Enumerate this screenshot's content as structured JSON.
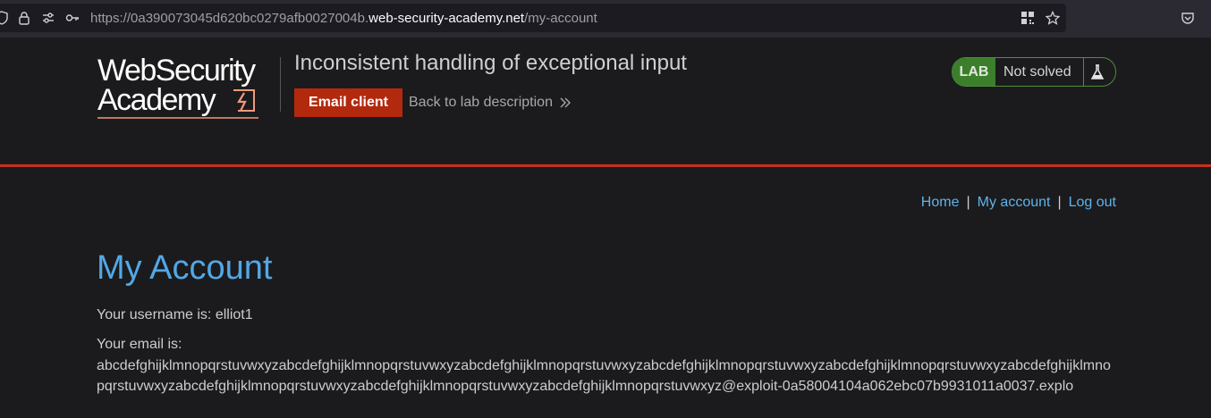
{
  "browser": {
    "url_prefix": "https://0a390073045d620bc0279afb0027004b.",
    "url_domain": "web-security-academy.net",
    "url_path": "/my-account"
  },
  "header": {
    "logo_line1": "WebSecurity",
    "logo_line2": "Academy",
    "lab_title": "Inconsistent handling of exceptional input",
    "email_client_label": "Email client",
    "back_link_label": "Back to lab description",
    "lab_badge": "LAB",
    "lab_status": "Not solved"
  },
  "nav": {
    "home": "Home",
    "separator": "|",
    "my_account": "My account",
    "log_out": "Log out"
  },
  "account": {
    "title": "My Account",
    "username_line": "Your username is: elliot1",
    "email_label": "Your email is:",
    "email_value": "abcdefghijklmnopqrstuvwxyzabcdefghijklmnopqrstuvwxyzabcdefghijklmnopqrstuvwxyzabcdefghijklmnopqrstuvwxyzabcdefghijklmnopqrstuvwxyzabcdefghijklmnopqrstuvwxyzabcdefghijklmnopqrstuvwxyzabcdefghijklmnopqrstuvwxyzabcdefghijklmnopqrstuvwxyz@exploit-0a58004104a062ebc07b9931011a0037.explo"
  },
  "colors": {
    "accent_red": "#b3290e",
    "link_blue": "#5fb3ea",
    "title_blue": "#52a8e6",
    "lab_green": "#3c7f2b"
  },
  "icons": [
    "shield-icon",
    "lock-icon",
    "permissions-icon",
    "key-icon",
    "qr-icon",
    "bookmark-star-icon",
    "pocket-icon",
    "chevron-double-right-icon",
    "flask-icon",
    "logo-lightning-icon"
  ]
}
